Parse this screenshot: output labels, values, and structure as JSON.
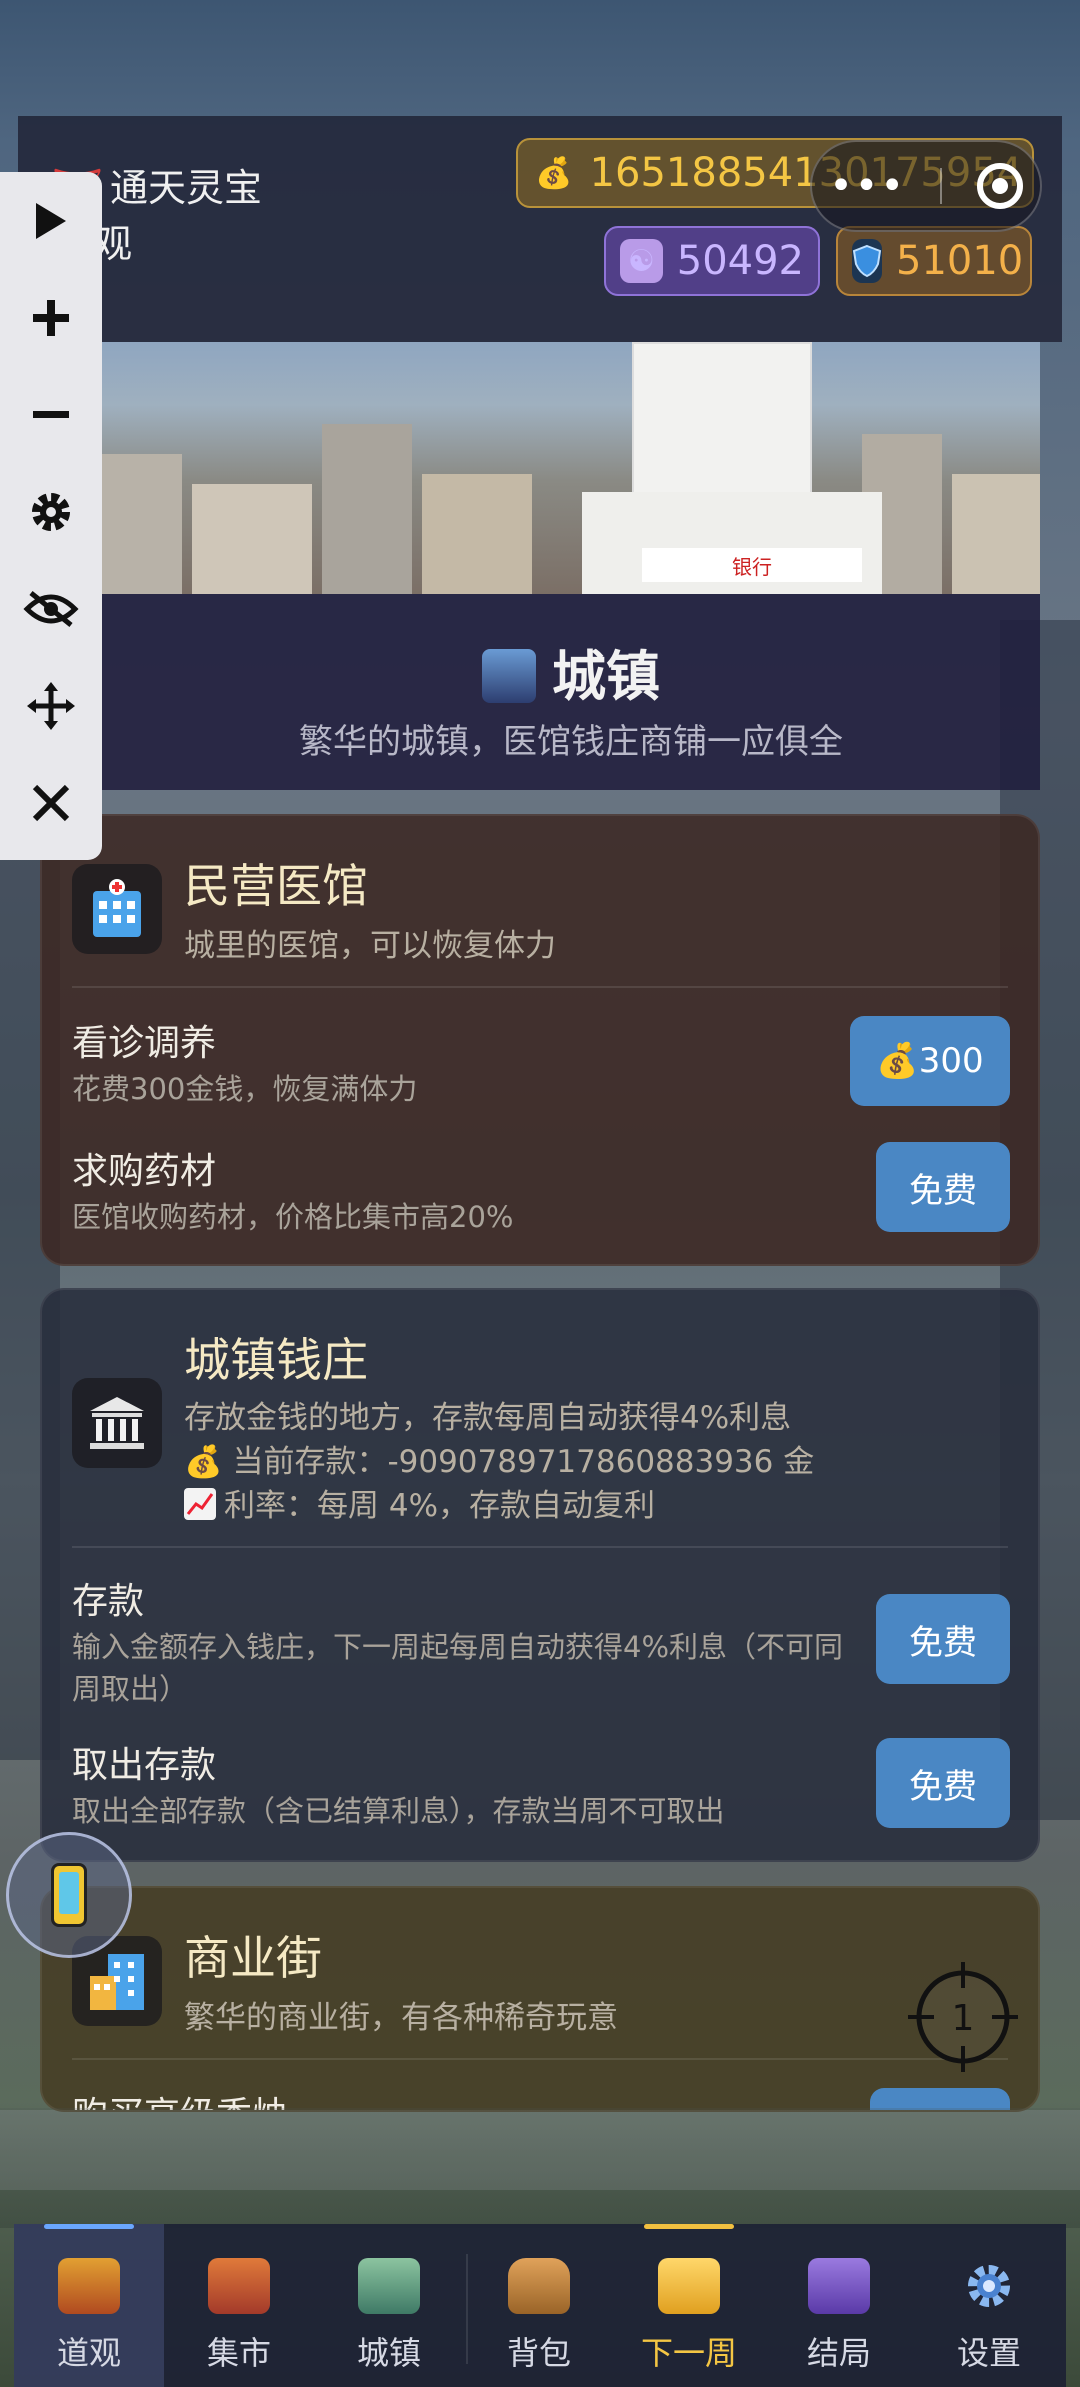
{
  "header": {
    "title_line1": "通天灵宝",
    "title_line2": "仙观",
    "money": "16518854130175954",
    "yin": "50492",
    "shield": "51010"
  },
  "town": {
    "title": "城镇",
    "subtitle": "繁华的城镇，医馆钱庄商铺一应俱全",
    "bank_sign": "银行"
  },
  "hospital": {
    "title": "民营医馆",
    "desc": "城里的医馆，可以恢复体力",
    "actions": [
      {
        "title": "看诊调养",
        "desc": "花费300金钱，恢复满体力",
        "button": "💰300"
      },
      {
        "title": "求购药材",
        "desc": "医馆收购药材，价格比集市高20%",
        "button": "免费"
      }
    ]
  },
  "bank": {
    "title": "城镇钱庄",
    "desc": "存放金钱的地方，存款每周自动获得4%利息",
    "deposit_line": "当前存款：-9090789717860883936 金",
    "rate_line": "利率：每周 4%，存款自动复利",
    "actions": [
      {
        "title": "存款",
        "desc": "输入金额存入钱庄，下一周起每周自动获得4%利息（不可同周取出）",
        "button": "免费"
      },
      {
        "title": "取出存款",
        "desc": "取出全部存款（含已结算利息），存款当周不可取出",
        "button": "免费"
      }
    ]
  },
  "street": {
    "title": "商业街",
    "desc": "繁华的商业街，有各种稀奇玩意",
    "next_row": "购买高级香烛"
  },
  "crosshair_label": "1",
  "nav": [
    {
      "label": "道观",
      "icon": "temple-icon",
      "color": "#e2a032"
    },
    {
      "label": "集市",
      "icon": "market-icon",
      "color": "#c8503a"
    },
    {
      "label": "城镇",
      "icon": "town-icon",
      "color": "#6aa08a"
    },
    {
      "label": "背包",
      "icon": "backpack-icon",
      "color": "#c98a3c"
    },
    {
      "label": "下一周",
      "icon": "calendar-icon",
      "color": "#f2c040"
    },
    {
      "label": "结局",
      "icon": "scroll-icon",
      "color": "#7a5ac8"
    },
    {
      "label": "设置",
      "icon": "gear-icon",
      "color": "#7aa8e8"
    }
  ],
  "colors": {
    "button": "#4a87c4",
    "money": "#f4c644",
    "yin": "#c9b6ff",
    "shield": "#f4b14a"
  }
}
